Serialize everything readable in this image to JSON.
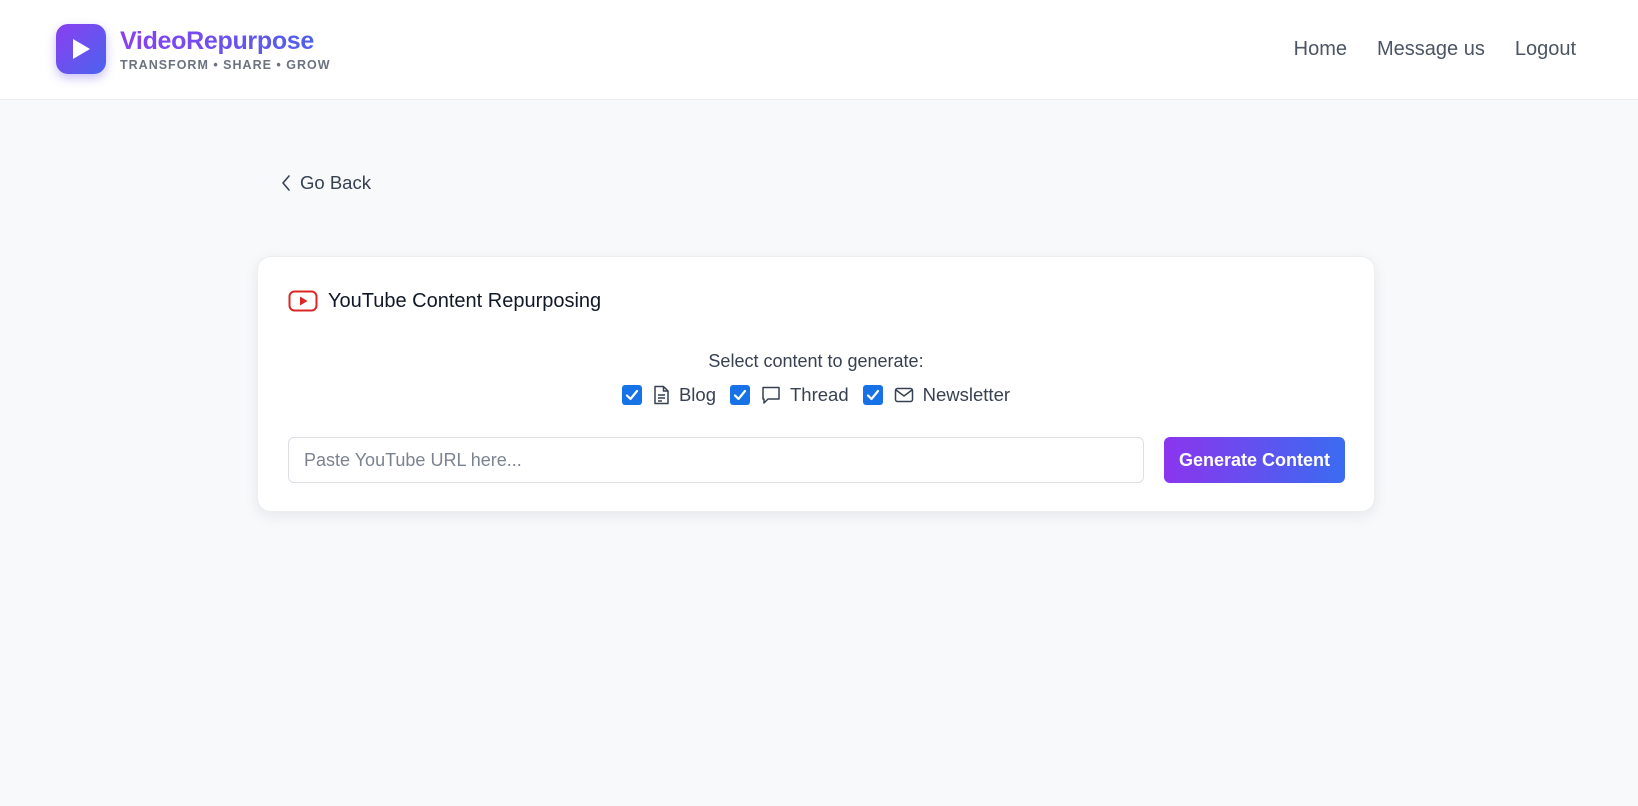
{
  "brand": {
    "name": "VideoRepurpose",
    "tagline": "TRANSFORM • SHARE • GROW",
    "logo_icon": "play-icon",
    "gradient_start": "#8b3ff0",
    "gradient_end": "#4a63ee"
  },
  "nav": {
    "items": [
      {
        "label": "Home"
      },
      {
        "label": "Message us"
      },
      {
        "label": "Logout"
      }
    ]
  },
  "back": {
    "label": "Go Back",
    "icon": "chevron-left-icon"
  },
  "card": {
    "title": "YouTube Content Repurposing",
    "title_icon": "youtube-icon",
    "select_label": "Select content to generate:",
    "options": [
      {
        "label": "Blog",
        "checked": true,
        "icon": "document-icon"
      },
      {
        "label": "Thread",
        "checked": true,
        "icon": "chat-bubble-icon"
      },
      {
        "label": "Newsletter",
        "checked": true,
        "icon": "mail-icon"
      }
    ],
    "url_input": {
      "placeholder": "Paste YouTube URL here...",
      "value": ""
    },
    "generate_label": "Generate Content"
  },
  "colors": {
    "checkbox": "#1672e6",
    "youtube_red": "#dc2626",
    "button_gradient_start": "#8b35ee",
    "button_gradient_end": "#3a6cf0"
  }
}
